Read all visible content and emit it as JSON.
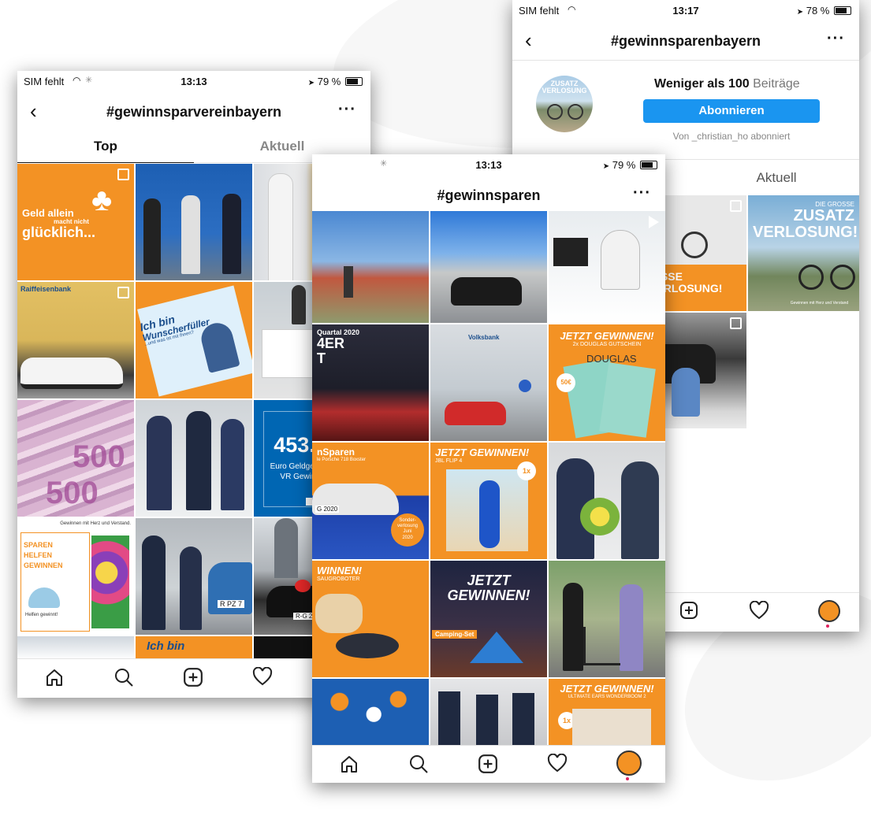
{
  "phone_left": {
    "status": {
      "carrier": "SIM fehlt",
      "time": "13:13",
      "battery": "79 %"
    },
    "title": "#gewinnsparvereinbayern",
    "tabs": [
      "Top",
      "Aktuell"
    ],
    "tiles": {
      "t0": [
        "Geld allein",
        "macht nicht",
        "glücklich..."
      ],
      "t3": "Raiffeisenbank",
      "t4": [
        "Ich bin",
        "Wunscherfüller",
        "...und was ist mit Ihnen?"
      ],
      "t8": [
        "453.830",
        "Euro Geldgewinne beim",
        "VR Gewinnsparen"
      ],
      "t9": [
        "Gewinnen mit",
        "Herz",
        "und Verstand.",
        "SPAREN",
        "HELFEN",
        "GEWINNEN",
        "Helfen gewinnt!"
      ],
      "t10": "R PZ 7",
      "t11": "R-G 2021",
      "t13": "Ich bin"
    }
  },
  "phone_middle": {
    "status": {
      "time": "13:13",
      "battery": "79 %"
    },
    "title": "#gewinnsparen",
    "tiles": {
      "m3": [
        "Quartal 2020",
        "4ER",
        "T"
      ],
      "m4": "Volksbank",
      "m5": [
        "JETZT GEWINNEN!",
        "2x DOUGLAS GUTSCHEIN",
        "50€",
        "DOUGLAS"
      ],
      "m6": [
        "nSparen",
        "le Porsche 718 Boxster",
        "Sonder-",
        "verlosung",
        "Juni",
        "2020",
        "G 2020"
      ],
      "m7": [
        "JETZT GEWINNEN!",
        "JBL FLIP 4",
        "1x"
      ],
      "m9": [
        "WINNEN!",
        "SAUGROBOTER"
      ],
      "m10": [
        "JETZT",
        "GEWINNEN!",
        "Camping-Set"
      ],
      "m14": [
        "JETZT GEWINNEN!",
        "ULTIMATE EARS WONDERBOOM 2",
        "1x"
      ]
    }
  },
  "phone_right": {
    "status": {
      "carrier": "SIM fehlt",
      "time": "13:17",
      "battery": "78 %"
    },
    "title": "#gewinnsparenbayern",
    "profile_image_text": [
      "ZUSATZ",
      "VERLOSUNG"
    ],
    "posts_count": "Weniger als 100",
    "posts_label": "Beiträge",
    "follow_label": "Abonnieren",
    "followed_by": "Von _christian_ho abonniert",
    "tab_latest": "Aktuell",
    "tiles": {
      "r0": [
        "GROSSE",
        "TZVERLOSUNG!"
      ],
      "r1": [
        "DIE GROSSE",
        "ZUSATZ",
        "VERLOSUNG!",
        "Gewinnen mit",
        "Herz",
        "und Verstand"
      ]
    }
  },
  "colors": {
    "accent": "#f39224",
    "blue": "#1a95f0",
    "vr_blue": "#0066b3"
  }
}
